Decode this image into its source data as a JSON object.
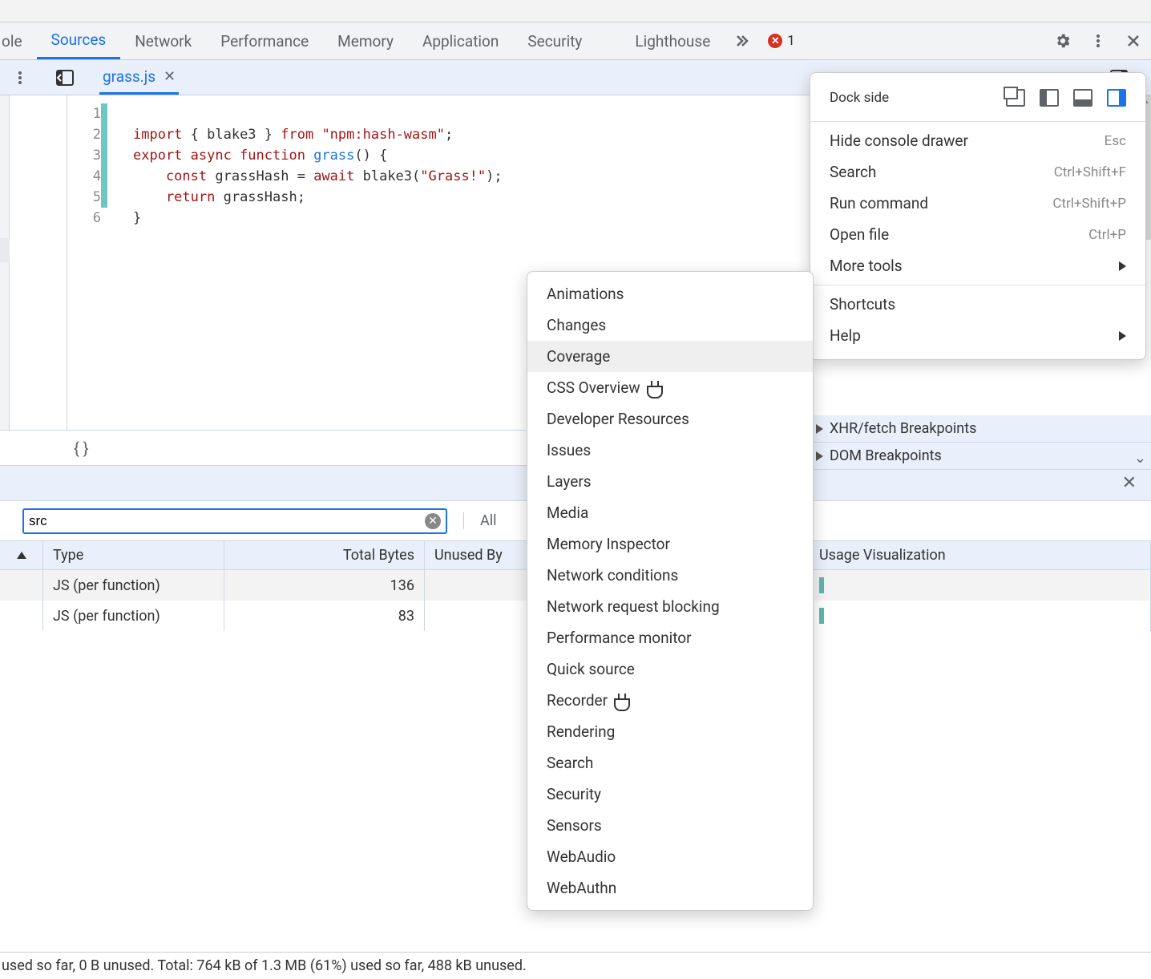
{
  "tabs": {
    "partial": "ole",
    "items": [
      "Sources",
      "Network",
      "Performance",
      "Memory",
      "Application",
      "Security",
      "Lighthouse"
    ],
    "active_index": 0,
    "error_count": "1"
  },
  "file_tab": {
    "name": "grass.js"
  },
  "code": {
    "line_numbers": [
      "1",
      "2",
      "3",
      "4",
      "5",
      "6"
    ],
    "l1_a": "import",
    "l1_b": " { blake3 } ",
    "l1_c": "from",
    "l1_d": " \"npm:hash-wasm\"",
    "l1_e": ";",
    "l2_a": "export async function",
    "l2_b": " grass",
    "l2_c": "() {",
    "l3_a": "    const",
    "l3_b": " grassHash = ",
    "l3_c": "await",
    "l3_d": " blake3(",
    "l3_e": "\"Grass!\"",
    "l3_f": ");",
    "l4_a": "    return",
    "l4_b": " grassHash;",
    "l5": "}"
  },
  "pretty_print": "{ }",
  "filter": {
    "value": "src",
    "all_label": "All"
  },
  "coverage_table": {
    "headers": {
      "type": "Type",
      "total_bytes": "Total Bytes",
      "unused": "Unused By",
      "viz": "Usage Visualization"
    },
    "rows": [
      {
        "type": "JS (per function)",
        "total_bytes": "136"
      },
      {
        "type": "JS (per function)",
        "total_bytes": "83"
      }
    ]
  },
  "right_pane": {
    "xhr": "XHR/fetch Breakpoints",
    "dom": "DOM Breakpoints"
  },
  "status": "used so far, 0 B unused. Total: 764 kB of 1.3 MB (61%) used so far, 488 kB unused.",
  "popover": {
    "dock_label": "Dock side",
    "items": [
      {
        "label": "Hide console drawer",
        "shortcut": "Esc"
      },
      {
        "label": "Search",
        "shortcut": "Ctrl+Shift+F"
      },
      {
        "label": "Run command",
        "shortcut": "Ctrl+Shift+P"
      },
      {
        "label": "Open file",
        "shortcut": "Ctrl+P"
      },
      {
        "label": "More tools",
        "chevron": true
      }
    ],
    "items2": [
      {
        "label": "Shortcuts"
      },
      {
        "label": "Help",
        "chevron": true
      }
    ]
  },
  "submenu": {
    "items": [
      {
        "label": "Animations"
      },
      {
        "label": "Changes"
      },
      {
        "label": "Coverage",
        "hl": true
      },
      {
        "label": "CSS Overview",
        "flask": true
      },
      {
        "label": "Developer Resources"
      },
      {
        "label": "Issues"
      },
      {
        "label": "Layers"
      },
      {
        "label": "Media"
      },
      {
        "label": "Memory Inspector"
      },
      {
        "label": "Network conditions"
      },
      {
        "label": "Network request blocking"
      },
      {
        "label": "Performance monitor"
      },
      {
        "label": "Quick source"
      },
      {
        "label": "Recorder",
        "flask": true
      },
      {
        "label": "Rendering"
      },
      {
        "label": "Search"
      },
      {
        "label": "Security"
      },
      {
        "label": "Sensors"
      },
      {
        "label": "WebAudio"
      },
      {
        "label": "WebAuthn"
      }
    ]
  }
}
